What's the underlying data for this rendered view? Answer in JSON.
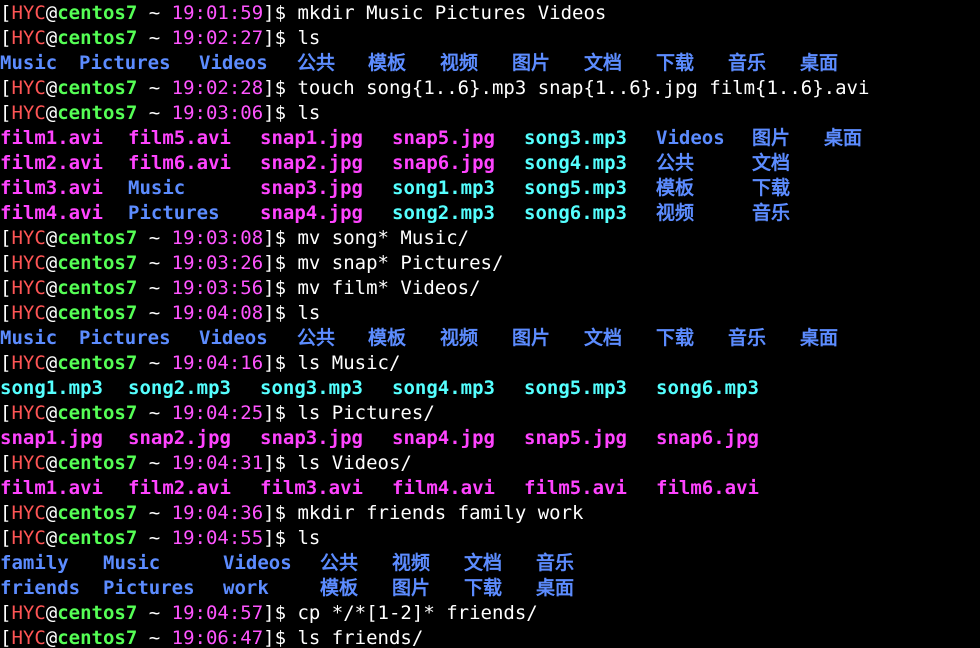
{
  "colors": {
    "background": "#000000",
    "user": "#ff5555",
    "host": "#55ff55",
    "time": "#ff55ff",
    "directory": "#5c8cff",
    "audio": "#55ffff",
    "image": "#ff44ff",
    "video": "#ff44ff"
  },
  "prompt": {
    "user": "HYC",
    "at": "@",
    "host": "centos7",
    "tilde": "~"
  },
  "lines": [
    {
      "kind": "prompt",
      "time": "19:01:59",
      "cmd": "mkdir Music Pictures Videos"
    },
    {
      "kind": "prompt",
      "time": "19:02:27",
      "cmd": "ls"
    },
    {
      "kind": "files",
      "items": [
        {
          "text": "Music",
          "type": "dir",
          "col": 0
        },
        {
          "text": "Pictures",
          "type": "dir",
          "col": 79
        },
        {
          "text": "Videos",
          "type": "dir",
          "col": 199
        },
        {
          "text": "公共",
          "type": "dir",
          "col": 297
        },
        {
          "text": "模板",
          "type": "dir",
          "col": 368
        },
        {
          "text": "视频",
          "type": "dir",
          "col": 440
        },
        {
          "text": "图片",
          "type": "dir",
          "col": 512
        },
        {
          "text": "文档",
          "type": "dir",
          "col": 584
        },
        {
          "text": "下载",
          "type": "dir",
          "col": 656
        },
        {
          "text": "音乐",
          "type": "dir",
          "col": 728
        },
        {
          "text": "桌面",
          "type": "dir",
          "col": 800
        }
      ]
    },
    {
      "kind": "prompt",
      "time": "19:02:28",
      "cmd": "touch song{1..6}.mp3 snap{1..6}.jpg film{1..6}.avi"
    },
    {
      "kind": "prompt",
      "time": "19:03:06",
      "cmd": "ls"
    },
    {
      "kind": "files",
      "items": [
        {
          "text": "film1.avi",
          "type": "avi",
          "col": 0
        },
        {
          "text": "film5.avi",
          "type": "avi",
          "col": 128
        },
        {
          "text": "snap1.jpg",
          "type": "jpg",
          "col": 260
        },
        {
          "text": "snap5.jpg",
          "type": "jpg",
          "col": 392
        },
        {
          "text": "song3.mp3",
          "type": "mp3",
          "col": 524
        },
        {
          "text": "Videos",
          "type": "dir",
          "col": 656
        },
        {
          "text": "图片",
          "type": "dir",
          "col": 752
        },
        {
          "text": "桌面",
          "type": "dir",
          "col": 824
        }
      ]
    },
    {
      "kind": "files",
      "items": [
        {
          "text": "film2.avi",
          "type": "avi",
          "col": 0
        },
        {
          "text": "film6.avi",
          "type": "avi",
          "col": 128
        },
        {
          "text": "snap2.jpg",
          "type": "jpg",
          "col": 260
        },
        {
          "text": "snap6.jpg",
          "type": "jpg",
          "col": 392
        },
        {
          "text": "song4.mp3",
          "type": "mp3",
          "col": 524
        },
        {
          "text": "公共",
          "type": "dir",
          "col": 656
        },
        {
          "text": "文档",
          "type": "dir",
          "col": 752
        }
      ]
    },
    {
      "kind": "files",
      "items": [
        {
          "text": "film3.avi",
          "type": "avi",
          "col": 0
        },
        {
          "text": "Music",
          "type": "dir",
          "col": 128
        },
        {
          "text": "snap3.jpg",
          "type": "jpg",
          "col": 260
        },
        {
          "text": "song1.mp3",
          "type": "mp3",
          "col": 392
        },
        {
          "text": "song5.mp3",
          "type": "mp3",
          "col": 524
        },
        {
          "text": "模板",
          "type": "dir",
          "col": 656
        },
        {
          "text": "下载",
          "type": "dir",
          "col": 752
        }
      ]
    },
    {
      "kind": "files",
      "items": [
        {
          "text": "film4.avi",
          "type": "avi",
          "col": 0
        },
        {
          "text": "Pictures",
          "type": "dir",
          "col": 128
        },
        {
          "text": "snap4.jpg",
          "type": "jpg",
          "col": 260
        },
        {
          "text": "song2.mp3",
          "type": "mp3",
          "col": 392
        },
        {
          "text": "song6.mp3",
          "type": "mp3",
          "col": 524
        },
        {
          "text": "视频",
          "type": "dir",
          "col": 656
        },
        {
          "text": "音乐",
          "type": "dir",
          "col": 752
        }
      ]
    },
    {
      "kind": "prompt",
      "time": "19:03:08",
      "cmd": "mv song* Music/"
    },
    {
      "kind": "prompt",
      "time": "19:03:26",
      "cmd": "mv snap* Pictures/"
    },
    {
      "kind": "prompt",
      "time": "19:03:56",
      "cmd": "mv film* Videos/"
    },
    {
      "kind": "prompt",
      "time": "19:04:08",
      "cmd": "ls"
    },
    {
      "kind": "files",
      "items": [
        {
          "text": "Music",
          "type": "dir",
          "col": 0
        },
        {
          "text": "Pictures",
          "type": "dir",
          "col": 79
        },
        {
          "text": "Videos",
          "type": "dir",
          "col": 199
        },
        {
          "text": "公共",
          "type": "dir",
          "col": 297
        },
        {
          "text": "模板",
          "type": "dir",
          "col": 368
        },
        {
          "text": "视频",
          "type": "dir",
          "col": 440
        },
        {
          "text": "图片",
          "type": "dir",
          "col": 512
        },
        {
          "text": "文档",
          "type": "dir",
          "col": 584
        },
        {
          "text": "下载",
          "type": "dir",
          "col": 656
        },
        {
          "text": "音乐",
          "type": "dir",
          "col": 728
        },
        {
          "text": "桌面",
          "type": "dir",
          "col": 800
        }
      ]
    },
    {
      "kind": "prompt",
      "time": "19:04:16",
      "cmd": "ls Music/"
    },
    {
      "kind": "files",
      "items": [
        {
          "text": "song1.mp3",
          "type": "mp3",
          "col": 0
        },
        {
          "text": "song2.mp3",
          "type": "mp3",
          "col": 128
        },
        {
          "text": "song3.mp3",
          "type": "mp3",
          "col": 260
        },
        {
          "text": "song4.mp3",
          "type": "mp3",
          "col": 392
        },
        {
          "text": "song5.mp3",
          "type": "mp3",
          "col": 524
        },
        {
          "text": "song6.mp3",
          "type": "mp3",
          "col": 656
        }
      ]
    },
    {
      "kind": "prompt",
      "time": "19:04:25",
      "cmd": "ls Pictures/"
    },
    {
      "kind": "files",
      "items": [
        {
          "text": "snap1.jpg",
          "type": "jpg",
          "col": 0
        },
        {
          "text": "snap2.jpg",
          "type": "jpg",
          "col": 128
        },
        {
          "text": "snap3.jpg",
          "type": "jpg",
          "col": 260
        },
        {
          "text": "snap4.jpg",
          "type": "jpg",
          "col": 392
        },
        {
          "text": "snap5.jpg",
          "type": "jpg",
          "col": 524
        },
        {
          "text": "snap6.jpg",
          "type": "jpg",
          "col": 656
        }
      ]
    },
    {
      "kind": "prompt",
      "time": "19:04:31",
      "cmd": "ls Videos/"
    },
    {
      "kind": "files",
      "items": [
        {
          "text": "film1.avi",
          "type": "avi",
          "col": 0
        },
        {
          "text": "film2.avi",
          "type": "avi",
          "col": 128
        },
        {
          "text": "film3.avi",
          "type": "avi",
          "col": 260
        },
        {
          "text": "film4.avi",
          "type": "avi",
          "col": 392
        },
        {
          "text": "film5.avi",
          "type": "avi",
          "col": 524
        },
        {
          "text": "film6.avi",
          "type": "avi",
          "col": 656
        }
      ]
    },
    {
      "kind": "prompt",
      "time": "19:04:36",
      "cmd": "mkdir friends family work"
    },
    {
      "kind": "prompt",
      "time": "19:04:55",
      "cmd": "ls"
    },
    {
      "kind": "files",
      "items": [
        {
          "text": "family",
          "type": "dir",
          "col": 0
        },
        {
          "text": "Music",
          "type": "dir",
          "col": 103
        },
        {
          "text": "Videos",
          "type": "dir",
          "col": 223
        },
        {
          "text": "公共",
          "type": "dir",
          "col": 320
        },
        {
          "text": "视频",
          "type": "dir",
          "col": 392
        },
        {
          "text": "文档",
          "type": "dir",
          "col": 464
        },
        {
          "text": "音乐",
          "type": "dir",
          "col": 536
        }
      ]
    },
    {
      "kind": "files",
      "items": [
        {
          "text": "friends",
          "type": "dir",
          "col": 0
        },
        {
          "text": "Pictures",
          "type": "dir",
          "col": 103
        },
        {
          "text": "work",
          "type": "dir",
          "col": 223
        },
        {
          "text": "模板",
          "type": "dir",
          "col": 320
        },
        {
          "text": "图片",
          "type": "dir",
          "col": 392
        },
        {
          "text": "下载",
          "type": "dir",
          "col": 464
        },
        {
          "text": "桌面",
          "type": "dir",
          "col": 536
        }
      ]
    },
    {
      "kind": "prompt",
      "time": "19:04:57",
      "cmd": "cp */*[1-2]* friends/"
    },
    {
      "kind": "prompt",
      "time": "19:06:47",
      "cmd": "ls friends/"
    }
  ]
}
